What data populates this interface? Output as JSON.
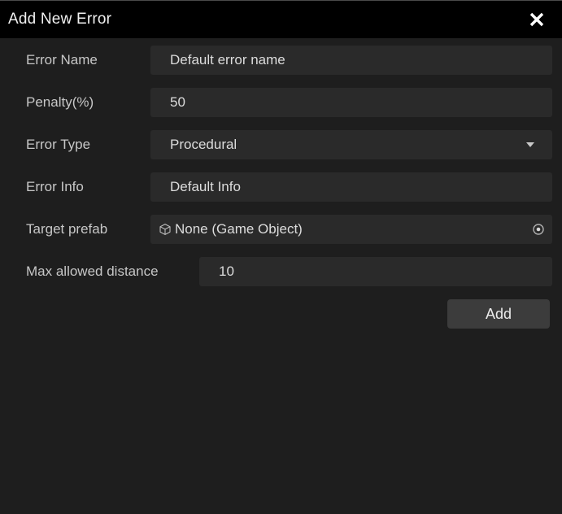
{
  "window": {
    "title": "Add New Error",
    "close_icon": "close-icon",
    "background_color": "#1e1e1e",
    "titlebar_color": "#000000"
  },
  "form": {
    "fields": [
      {
        "label": "Error Name",
        "value": "Default error name",
        "type": "text"
      },
      {
        "label": "Penalty(%)",
        "value": "50",
        "type": "number"
      },
      {
        "label": "Error Type",
        "value": "Procedural",
        "type": "dropdown",
        "dropdown_icon": "chevron-down-icon"
      },
      {
        "label": "Error Info",
        "value": "Default Info",
        "type": "text"
      },
      {
        "label": "Target prefab",
        "value": "None (Game Object)",
        "type": "object",
        "object_icon": "cube-icon",
        "picker_icon": "object-picker-icon"
      },
      {
        "label": "Max allowed distance",
        "value": "10",
        "type": "number"
      }
    ]
  },
  "actions": {
    "add_label": "Add",
    "add_button_color": "#3c3c3c"
  }
}
